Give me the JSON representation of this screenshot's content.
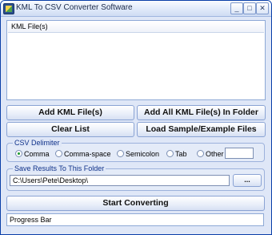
{
  "window": {
    "title": "KML To CSV Converter Software",
    "min_glyph": "_",
    "max_glyph": "□",
    "close_glyph": "✕"
  },
  "file_list": {
    "column_header": "KML File(s)"
  },
  "buttons": {
    "add_files": "Add KML File(s)",
    "add_all_in_folder": "Add All KML File(s) In Folder",
    "clear_list": "Clear List",
    "load_sample": "Load Sample/Example Files",
    "browse": "...",
    "start": "Start Converting"
  },
  "csv_delimiter": {
    "legend": "CSV Delimiter",
    "options": [
      "Comma",
      "Comma-space",
      "Semicolon",
      "Tab",
      "Other"
    ],
    "selected": "Comma",
    "other_value": ""
  },
  "save_folder": {
    "legend": "Save Results To This Folder",
    "path": "C:\\Users\\Pete\\Desktop\\"
  },
  "progress": {
    "label": "Progress Bar"
  }
}
